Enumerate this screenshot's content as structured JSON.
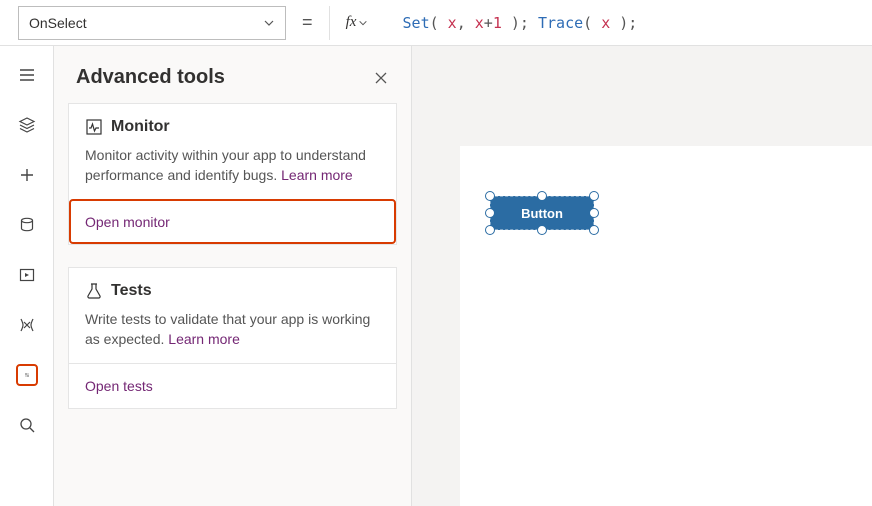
{
  "formulaBar": {
    "property": "OnSelect",
    "fx": "fx",
    "tokens": [
      {
        "t": "fn",
        "v": "Set"
      },
      {
        "t": "punc",
        "v": "( "
      },
      {
        "t": "var",
        "v": "x"
      },
      {
        "t": "punc",
        "v": ", "
      },
      {
        "t": "var",
        "v": "x"
      },
      {
        "t": "punc",
        "v": "+"
      },
      {
        "t": "num",
        "v": "1"
      },
      {
        "t": "punc",
        "v": " ); "
      },
      {
        "t": "fn",
        "v": "Trace"
      },
      {
        "t": "punc",
        "v": "( "
      },
      {
        "t": "var",
        "v": "x"
      },
      {
        "t": "punc",
        "v": " );"
      }
    ]
  },
  "rail": {
    "items": [
      {
        "name": "hamburger-icon"
      },
      {
        "name": "layers-icon"
      },
      {
        "name": "plus-icon"
      },
      {
        "name": "data-icon"
      },
      {
        "name": "media-icon"
      },
      {
        "name": "variables-icon"
      },
      {
        "name": "tools-icon",
        "highlight": true
      },
      {
        "name": "search-icon"
      }
    ]
  },
  "panel": {
    "title": "Advanced tools",
    "cards": [
      {
        "icon": "pulse-icon",
        "title": "Monitor",
        "desc": "Monitor activity within your app to understand performance and identify bugs.",
        "learnMore": "Learn more",
        "action": "Open monitor",
        "actionHighlight": true
      },
      {
        "icon": "beaker-icon",
        "title": "Tests",
        "desc": "Write tests to validate that your app is working as expected.",
        "learnMore": "Learn more",
        "action": "Open tests",
        "actionHighlight": false
      }
    ]
  },
  "canvas": {
    "buttonLabel": "Button"
  }
}
